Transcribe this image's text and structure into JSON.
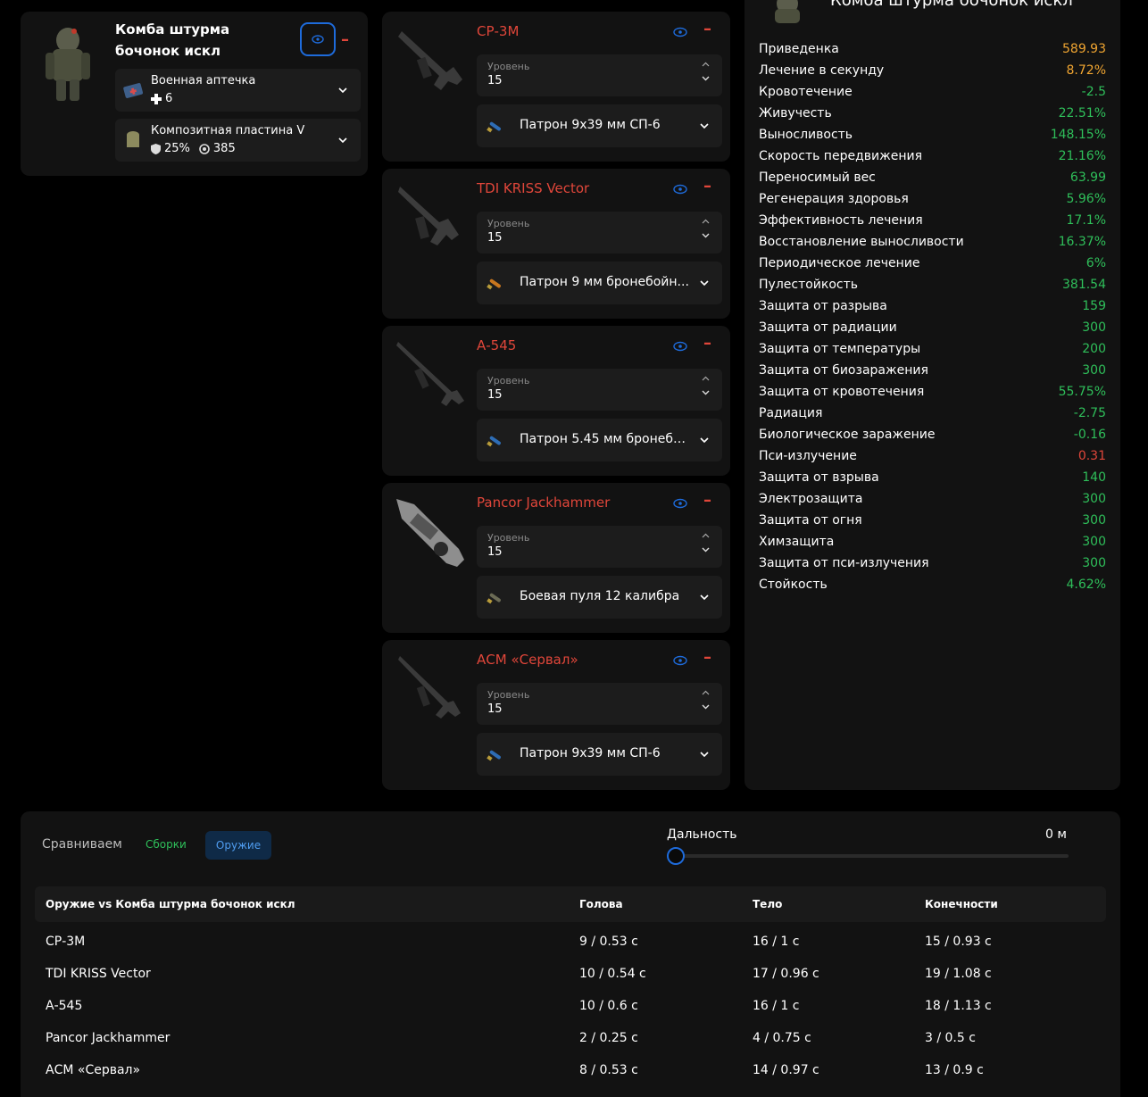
{
  "armor": {
    "title_line1": "Комба штурма",
    "title_line2": "бочонок искл",
    "minus": "–",
    "slots": [
      {
        "name": "Военная аптечка",
        "icon": "medkit-icon",
        "count": "6"
      },
      {
        "name": "Композитная пластина V",
        "icon": "plate-icon",
        "armor_pct": "25%",
        "protection": "385"
      }
    ]
  },
  "weapon_labels": {
    "level": "Уровень",
    "minus": "–"
  },
  "weapons": [
    {
      "name": "СР-3М",
      "level": "15",
      "ammo": "Патрон 9x39 мм СП-6"
    },
    {
      "name": "TDI KRISS Vector",
      "level": "15",
      "ammo": "Патрон 9 мм бронебойн..."
    },
    {
      "name": "А-545",
      "level": "15",
      "ammo": "Патрон 5.45 мм бронебо..."
    },
    {
      "name": "Pancor Jackhammer",
      "level": "15",
      "ammo": "Боевая пуля 12 калибра"
    },
    {
      "name": "АСМ «Сервал»",
      "level": "15",
      "ammo": "Патрон 9x39 мм СП-6"
    }
  ],
  "stats": {
    "title": "Комба штурма бочонок искл",
    "rows": [
      {
        "label": "Приведенка",
        "value": "589.93",
        "color": "#f0a531"
      },
      {
        "label": "Лечение в секунду",
        "value": "8.72%",
        "color": "#f0a531"
      },
      {
        "label": "Кровотечение",
        "value": "-2.5",
        "color": "#2fbf5a"
      },
      {
        "label": "Живучесть",
        "value": "22.51%",
        "color": "#2fbf5a"
      },
      {
        "label": "Выносливость",
        "value": "148.15%",
        "color": "#2fbf5a"
      },
      {
        "label": "Скорость передвижения",
        "value": "21.16%",
        "color": "#2fbf5a"
      },
      {
        "label": "Переносимый вес",
        "value": "63.99",
        "color": "#2fbf5a"
      },
      {
        "label": "Регенерация здоровья",
        "value": "5.96%",
        "color": "#2fbf5a"
      },
      {
        "label": "Эффективность лечения",
        "value": "17.1%",
        "color": "#2fbf5a"
      },
      {
        "label": "Восстановление выносливости",
        "value": "16.37%",
        "color": "#2fbf5a"
      },
      {
        "label": "Периодическое лечение",
        "value": "6%",
        "color": "#2fbf5a"
      },
      {
        "label": "Пулестойкость",
        "value": "381.54",
        "color": "#2fbf5a"
      },
      {
        "label": "Защита от разрыва",
        "value": "159",
        "color": "#2fbf5a"
      },
      {
        "label": "Защита от радиации",
        "value": "300",
        "color": "#2fbf5a"
      },
      {
        "label": "Защита от температуры",
        "value": "200",
        "color": "#2fbf5a"
      },
      {
        "label": "Защита от биозаражения",
        "value": "300",
        "color": "#2fbf5a"
      },
      {
        "label": "Защита от кровотечения",
        "value": "55.75%",
        "color": "#2fbf5a"
      },
      {
        "label": "Радиация",
        "value": "-2.75",
        "color": "#2fbf5a"
      },
      {
        "label": "Биологическое заражение",
        "value": "-0.16",
        "color": "#2fbf5a"
      },
      {
        "label": "Пси-излучение",
        "value": "0.31",
        "color": "#e0463a"
      },
      {
        "label": "Защита от взрыва",
        "value": "140",
        "color": "#2fbf5a"
      },
      {
        "label": "Электрозащита",
        "value": "300",
        "color": "#2fbf5a"
      },
      {
        "label": "Защита от огня",
        "value": "300",
        "color": "#2fbf5a"
      },
      {
        "label": "Химзащита",
        "value": "300",
        "color": "#2fbf5a"
      },
      {
        "label": "Защита от пси-излучения",
        "value": "300",
        "color": "#2fbf5a"
      },
      {
        "label": "Стойкость",
        "value": "4.62%",
        "color": "#2fbf5a"
      }
    ]
  },
  "compare": {
    "label": "Сравниваем",
    "tab_builds": "Сборки",
    "tab_weapons": "Оружие",
    "range_label": "Дальность",
    "range_value": "0 м",
    "range_fraction": 0,
    "headers": [
      "Оружие vs Комба штурма бочонок искл",
      "Голова",
      "Тело",
      "Конечности"
    ],
    "rows": [
      [
        "СР-3М",
        "9 / 0.53 с",
        "16 / 1 с",
        "15 / 0.93 с"
      ],
      [
        "TDI KRISS Vector",
        "10 / 0.54 с",
        "17 / 0.96 с",
        "19 / 1.08 с"
      ],
      [
        "А-545",
        "10 / 0.6 с",
        "16 / 1 с",
        "18 / 1.13 с"
      ],
      [
        "Pancor Jackhammer",
        "2 / 0.25 с",
        "4 / 0.75 с",
        "3 / 0.5 с"
      ],
      [
        "АСМ «Сервал»",
        "8 / 0.53 с",
        "14 / 0.97 с",
        "13 / 0.9 с"
      ]
    ]
  },
  "colors": {
    "accent_red": "#e0463a",
    "accent_blue": "#1e6bdb",
    "green": "#2fbf5a",
    "orange": "#f0a531"
  }
}
